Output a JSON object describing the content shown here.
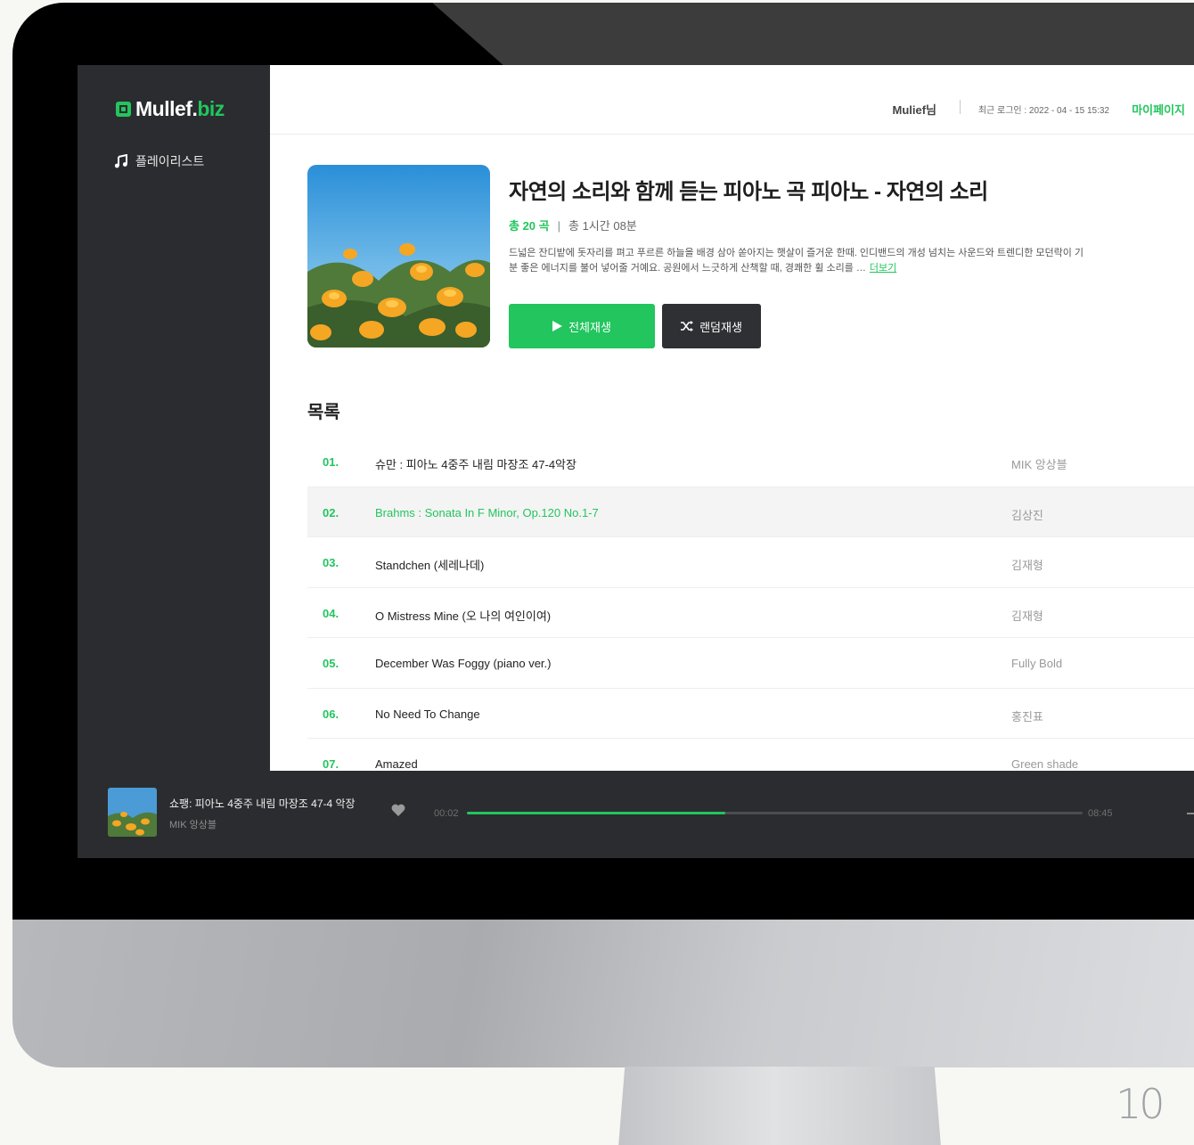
{
  "app": {
    "logo_main": "Mullef.",
    "logo_accent": "biz",
    "sidebar_items": [
      {
        "label": "플레이리스트"
      }
    ]
  },
  "header": {
    "user": "Mulief님",
    "last_login": "최근 로그인 : 2022 - 04 - 15  15:32",
    "mypage": "마이페이지"
  },
  "album": {
    "title": "자연의 소리와 함께 듣는 피아노 곡 피아노 - 자연의 소리",
    "count": "총 20 곡",
    "divider": "|",
    "duration": "총 1시간 08분",
    "description_line1": "드넓은 잔디밭에 돗자리를 펴고 푸르른 하늘을 배경 삼아 쏟아지는 햇살이 즐거운 한때. 인디밴드의 개성 넘치는 사운드와 트렌디한 모던락이 기",
    "description_line2": "분 좋은 에너지를 불어 넣어줄 거예요. 공원에서 느긋하게 산책할 때, 경쾌한 휠 소리를 …",
    "more_label": "더보기",
    "play_all_label": "전체재생",
    "shuffle_label": "랜덤재생"
  },
  "list": {
    "heading": "목록",
    "tracks": [
      {
        "num": "01.",
        "title": "슈만 : 피아노 4중주 내림 마장조 47-4악장",
        "artist": "MIK 앙상블"
      },
      {
        "num": "02.",
        "title": "Brahms : Sonata In F Minor, Op.120 No.1-7",
        "artist": "김상진"
      },
      {
        "num": "03.",
        "title": "Standchen (세레나데)",
        "artist": "김재형"
      },
      {
        "num": "04.",
        "title": "O Mistress Mine (오 나의 여인이여)",
        "artist": "김재형"
      },
      {
        "num": "05.",
        "title": "December Was Foggy (piano ver.)",
        "artist": "Fully Bold"
      },
      {
        "num": "06.",
        "title": "No Need To Change",
        "artist": "홍진표"
      },
      {
        "num": "07.",
        "title": "Amazed",
        "artist": "Green shade"
      }
    ]
  },
  "player": {
    "title": "쇼팽: 피아노 4중주 내림 마장조 47-4 악장",
    "artist": "MIK 앙상블",
    "time_current": "00:02",
    "time_total": "08:45",
    "progress_percent": 42
  },
  "page_number": "10",
  "colors": {
    "accent": "#22c55e",
    "sidebar": "#2b2c2f",
    "player": "#2b2c2f"
  }
}
